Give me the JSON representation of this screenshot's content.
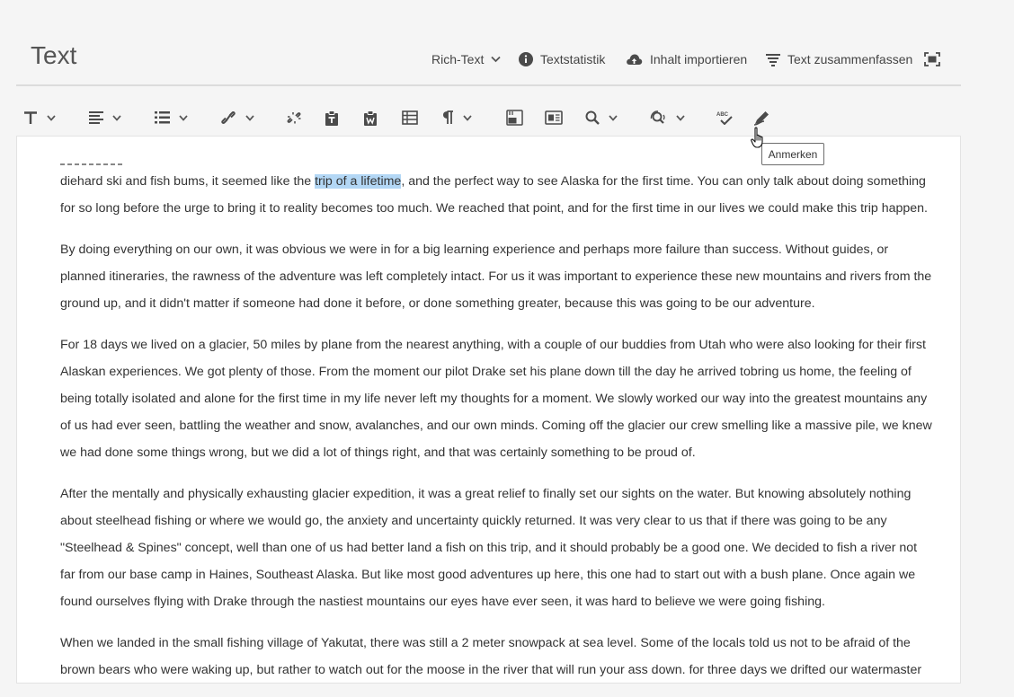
{
  "header": {
    "title": "Text",
    "format_dropdown": "Rich-Text",
    "stats": "Textstatistik",
    "import": "Inhalt importieren",
    "summarize": "Text zusammenfassen"
  },
  "toolbar": {
    "icons": [
      "text-format-icon",
      "align-icon",
      "list-icon",
      "link-icon",
      "unlink-icon",
      "paste-text-icon",
      "paste-word-icon",
      "table-icon",
      "paragraph-icon",
      "image-icon",
      "insert-media-icon",
      "search-icon",
      "find-replace-icon",
      "spellcheck-icon",
      "annotate-icon"
    ]
  },
  "tooltip": "Anmerken",
  "editor": {
    "p1": {
      "before": "diehard ski and fish bums, it seemed like the ",
      "highlight": "trip of a lifetime",
      "after": ", and the perfect way to see Alaska for the first time. You can only talk about doing something for so long before the urge to bring it to reality becomes too much. We reached that point, and for the first time in our lives we could make this trip happen."
    },
    "p2": "By doing everything on our own, it was obvious we were in for a big learning experience and perhaps more failure than success. Without guides, or planned itineraries, the rawness of the adventure was left completely intact. For us it was important to experience these new mountains and rivers from the ground up, and it didn't matter if someone had done it before, or done something greater, because this was going to be our adventure.",
    "p3": "For 18 days we lived on a glacier, 50 miles by plane from the nearest anything, with a couple of our buddies from Utah who were also looking for their first Alaskan experiences. We got plenty of those. From the moment our pilot Drake set his plane down till the day he arrived tobring us home, the feeling of being totally isolated and alone for the first time in my life never left my thoughts for a moment. We slowly worked our way into the greatest mountains any of us had ever seen, battling the weather and snow, avalanches, and our own minds. Coming off the glacier our crew smelling like a massive pile, we knew we had done some things wrong, but we did a lot of things right, and that was certainly something to be proud of.",
    "p4": "After the mentally and physically exhausting glacier expedition, it was a great relief to finally set our sights on the water. But knowing absolutely nothing about steelhead fishing or where we would go, the anxiety and uncertainty quickly returned. It was very clear to us that if there was going to be any \"Steelhead & Spines\" concept, well than one of us had better land a fish on this trip, and it should probably be a good one. We decided to fish a river not far from our base camp in Haines, Southeast Alaska. But like most good adventures up here, this one had to start out with a bush plane. Once again we found ourselves flying with Drake through the nastiest mountains our eyes have ever seen, it was hard to believe we were going fishing.",
    "p5": "When we landed in the small fishing village of Yakutat, there was still a 2 meter snowpack at sea level. Some of the locals told us not to be afraid of the brown bears who were waking up, but rather to watch out for the moose in the river that will run your ass down. for three days we drifted our watermaster"
  }
}
